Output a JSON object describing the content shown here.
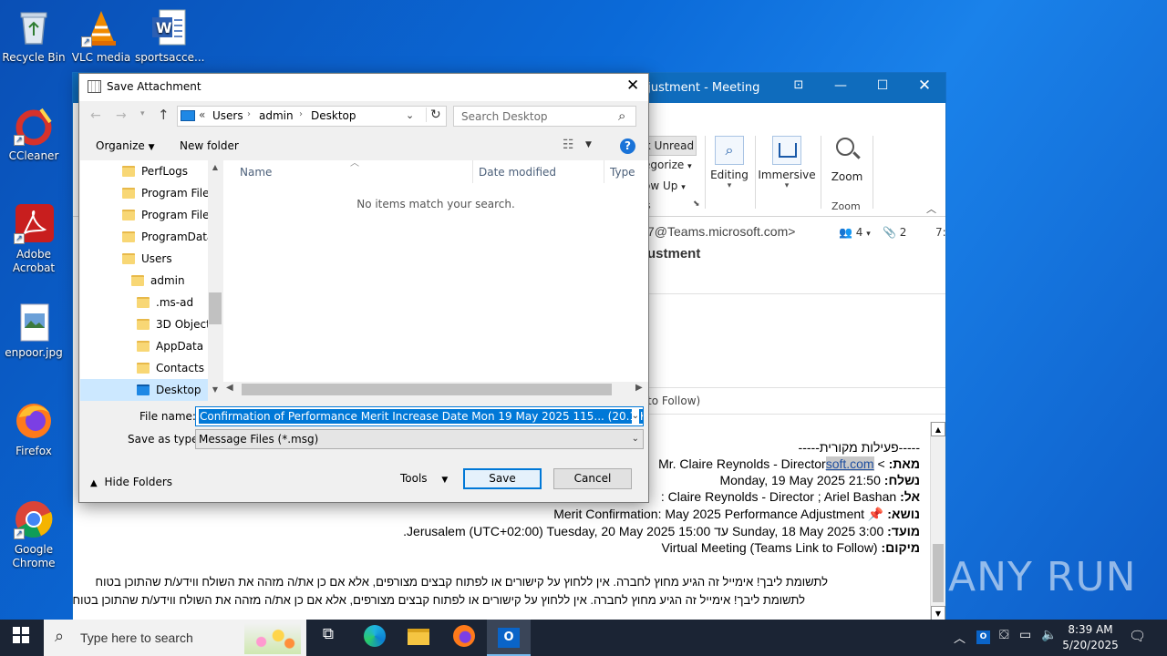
{
  "desktop": {
    "icons": [
      {
        "label": "Recycle Bin",
        "icon": "recycle-bin-icon"
      },
      {
        "label": "VLC media",
        "icon": "vlc-icon"
      },
      {
        "label": "sportsacce...",
        "icon": "word-document-icon"
      },
      {
        "label": "CCleaner",
        "icon": "ccleaner-icon"
      },
      {
        "label": "Adobe Acrobat",
        "icon": "acrobat-icon"
      },
      {
        "label": "enpoor.jpg",
        "icon": "image-file-icon"
      },
      {
        "label": "Firefox",
        "icon": "firefox-icon"
      },
      {
        "label": "Google Chrome",
        "icon": "chrome-icon"
      }
    ]
  },
  "outlook": {
    "title": "djustment  -  Meeting",
    "ribbon": {
      "unread": "k Unread",
      "categorize": "egorize",
      "followup": "ow Up",
      "group_tags": "s",
      "editing": "Editing",
      "immersive": "Immersive",
      "zoom": "Zoom",
      "zoom_group": "Zoom"
    },
    "header": {
      "from_addr": "7@Teams.microsoft.com>",
      "people_count": "4",
      "attach_count": "2",
      "time_frag": "7:",
      "subject_frag": "ustment",
      "location_frag": "to Follow)"
    },
    "body": {
      "orig_sep": "-----פעילות מקורית-----",
      "from_label": "מאת:",
      "from_link": "soft.com",
      "from_value": "> Mr. Claire Reynolds - Director",
      "sent_label": "נשלח:",
      "sent_value": "Monday, 19 May 2025 21:50",
      "to_label": "אל:",
      "to_value": "Claire Reynolds - Director ; Ariel Bashan :",
      "subject_label": "נושא:",
      "subject_value": "Merit Confirmation: May 2025 Performance Adjustment",
      "time_label": "מועד:",
      "time_value": "Sunday, 18 May 2025 3:00 עד Jerusalem (UTC+02:00) Tuesday, 20 May 2025 15:00.",
      "place_label": "מיקום:",
      "place_value": "Virtual Meeting (Teams Link to Follow)",
      "warn1": "לתשומת ליבך! אימייל זה הגיע מחוץ לחברה. אין ללחוץ על קישורים או לפתוח קבצים מצורפים, אלא אם כן את/ה מזהה את השולח ווידע/ת שהתוכן בטוח",
      "warn2": "לתשומת ליבך! אימייל זה הגיע מחוץ לחברה. אין ללחוץ על קישורים או לפתוח קבצים מצורפים, אלא אם כן את/ה מזהה את השולח ווידע/ת שהתוכן בטוח"
    }
  },
  "dialog": {
    "title": "Save Attachment",
    "address": {
      "prefix": "«",
      "crumbs": [
        "Users",
        "admin",
        "Desktop"
      ]
    },
    "search_placeholder": "Search Desktop",
    "toolbar": {
      "organize": "Organize",
      "new_folder": "New folder"
    },
    "tree": [
      {
        "label": "PerfLogs",
        "indent": 0
      },
      {
        "label": "Program Files",
        "indent": 0
      },
      {
        "label": "Program Files",
        "indent": 0
      },
      {
        "label": "ProgramData",
        "indent": 0
      },
      {
        "label": "Users",
        "indent": 0
      },
      {
        "label": "admin",
        "indent": 1
      },
      {
        "label": ".ms-ad",
        "indent": 2
      },
      {
        "label": "3D Objects",
        "indent": 2
      },
      {
        "label": "AppData",
        "indent": 2
      },
      {
        "label": "Contacts",
        "indent": 2
      },
      {
        "label": "Desktop",
        "indent": 2,
        "selected": true
      }
    ],
    "columns": [
      "Name",
      "Date modified",
      "Type"
    ],
    "empty_message": "No items match your search.",
    "filename_label": "File name:",
    "filename_value": "Confirmation of Performance Merit Increase  Date Mon 19 May 2025 115... (20.1 KB).msg",
    "savetype_label": "Save as type:",
    "savetype_value": "Message Files (*.msg)",
    "hide_folders": "Hide Folders",
    "tools": "Tools",
    "save": "Save",
    "cancel": "Cancel"
  },
  "taskbar": {
    "search_placeholder": "Type here to search",
    "time": "8:39 AM",
    "date": "5/20/2025"
  },
  "watermark": "ANY RUN"
}
